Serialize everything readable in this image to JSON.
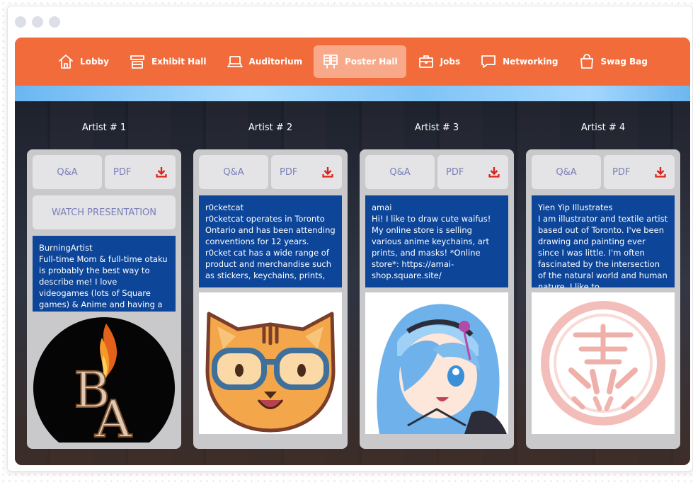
{
  "nav": {
    "items": [
      {
        "label": "Lobby",
        "icon": "home-icon"
      },
      {
        "label": "Exhibit Hall",
        "icon": "booth-icon"
      },
      {
        "label": "Auditorium",
        "icon": "laptop-icon"
      },
      {
        "label": "Poster Hall",
        "icon": "poster-icon",
        "active": true
      },
      {
        "label": "Jobs",
        "icon": "briefcase-icon"
      },
      {
        "label": "Networking",
        "icon": "chat-icon"
      },
      {
        "label": "Swag Bag",
        "icon": "bag-icon"
      }
    ]
  },
  "artists": [
    {
      "title": "Artist # 1",
      "qa_label": "Q&A",
      "pdf_label": "PDF",
      "watch_label": "WATCH PRESENTATION",
      "name": "BurningArtist",
      "description": "Full-time Mom & full-time otaku is probably the best way to describe me! I love videogames (lots of Square games) & Anime and having a good time! Please",
      "image_icon": "burningartist-logo-icon"
    },
    {
      "title": "Artist # 2",
      "qa_label": "Q&A",
      "pdf_label": "PDF",
      "name": "r0cketcat",
      "description": "r0cketcat operates in Toronto Ontario and has been attending conventions for 12 years. r0cket cat has a wide range of product and merchandise such as stickers, keychains, prints,",
      "image_icon": "cat-with-glasses-icon"
    },
    {
      "title": "Artist # 3",
      "qa_label": "Q&A",
      "pdf_label": "PDF",
      "name": "amai",
      "description": "Hi! I like to draw cute waifus! My online store is selling various anime keychains, art prints, and masks! *Online store*: https://amai-shop.square.site/",
      "image_icon": "anime-girl-illustration-icon"
    },
    {
      "title": "Artist # 4",
      "qa_label": "Q&A",
      "pdf_label": "PDF",
      "name": "Yien Yip Illustrates",
      "description": "I am illustrator and textile artist based out of Toronto. I've been drawing and painting ever since I was little. I'm often fascinated by the intersection of the natural world and human nature. I like to",
      "image_icon": "red-seal-stamp-icon"
    }
  ],
  "colors": {
    "nav_bg": "#f26b3a",
    "nav_active": "#f7a98a",
    "desc_bg": "#0d4599",
    "download_red": "#d9241c",
    "button_text": "#7a7fb8"
  }
}
